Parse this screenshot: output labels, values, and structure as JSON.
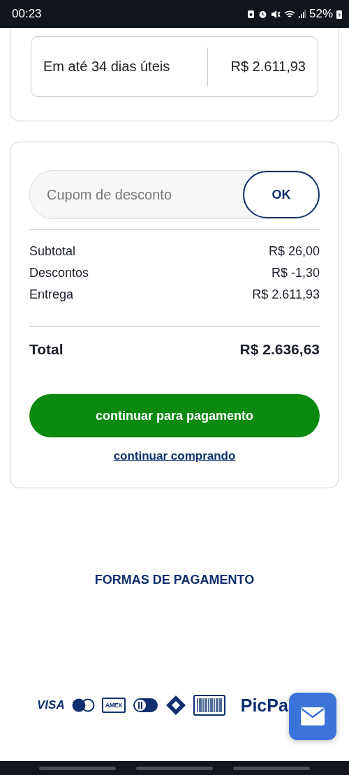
{
  "status_bar": {
    "time": "00:23",
    "battery": "52%"
  },
  "shipping_option": {
    "label": "Em até 34 dias úteis",
    "price": "R$ 2.611,93"
  },
  "coupon": {
    "placeholder": "Cupom de desconto",
    "button": "OK"
  },
  "summary": [
    {
      "label": "Subtotal",
      "value": "R$ 26,00"
    },
    {
      "label": "Descontos",
      "value": "R$ -1,30"
    },
    {
      "label": "Entrega",
      "value": "R$ 2.611,93"
    }
  ],
  "total": {
    "label": "Total",
    "value": "R$ 2.636,63"
  },
  "primary_button": "continuar para pagamento",
  "secondary_link": "continuar comprando",
  "payment_heading": "FORMAS DE PAGAMENTO",
  "payment_methods": [
    {
      "kind": "visa",
      "label": "VISA"
    },
    {
      "kind": "mastercard"
    },
    {
      "kind": "amex",
      "label": "AMEX"
    },
    {
      "kind": "diners"
    },
    {
      "kind": "pix"
    },
    {
      "kind": "boleto"
    },
    {
      "kind": "picpay",
      "label": "PicPa"
    }
  ]
}
